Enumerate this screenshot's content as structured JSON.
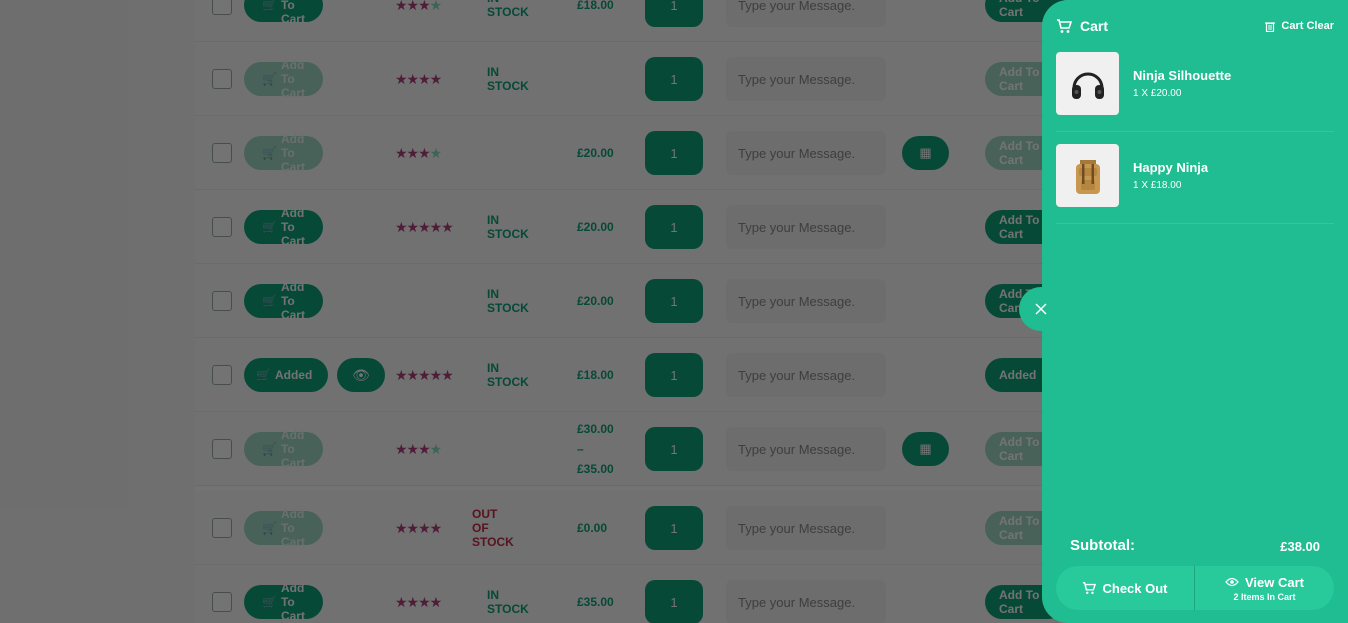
{
  "table": {
    "rows": [
      {
        "button": "Add To Cart",
        "button_state": "normal",
        "stars_on": 3,
        "stars_off": 1,
        "stock": "IN STOCK",
        "stock_type": "in",
        "price": "£18.00",
        "price_extra": "",
        "qty": "1",
        "msg_placeholder": "Type your Message.",
        "quick_view": false,
        "side_button": "Add To Cart",
        "side_faded": false
      },
      {
        "button": "Add To Cart",
        "button_state": "faded",
        "stars_on": 4,
        "stars_off": 0,
        "stock": "IN STOCK",
        "stock_type": "in",
        "price": "",
        "price_extra": "",
        "qty": "1",
        "msg_placeholder": "Type your Message.",
        "quick_view": false,
        "side_button": "Add To Cart",
        "side_faded": true
      },
      {
        "button": "Add To Cart",
        "button_state": "faded",
        "stars_on": 3,
        "stars_off": 1,
        "stock": "",
        "stock_type": "in",
        "price": "£20.00",
        "price_extra": "",
        "qty": "1",
        "msg_placeholder": "Type your Message.",
        "quick_view": true,
        "side_button": "Add To Cart",
        "side_faded": true
      },
      {
        "button": "Add To Cart",
        "button_state": "normal",
        "stars_on": 5,
        "stars_off": 0,
        "stock": "IN STOCK",
        "stock_type": "in",
        "price": "£20.00",
        "price_extra": "",
        "qty": "1",
        "msg_placeholder": "Type your Message.",
        "quick_view": false,
        "side_button": "Add To Cart",
        "side_faded": false
      },
      {
        "button": "Add To Cart",
        "button_state": "normal",
        "stars_on": 0,
        "stars_off": 0,
        "stock": "IN STOCK",
        "stock_type": "in",
        "price": "£20.00",
        "price_extra": "",
        "qty": "1",
        "msg_placeholder": "Type your Message.",
        "quick_view": false,
        "side_button": "Add To Cart",
        "side_faded": false
      },
      {
        "button": "Added",
        "button_state": "added",
        "stars_on": 5,
        "stars_off": 0,
        "stock": "IN STOCK",
        "stock_type": "in",
        "price": "£18.00",
        "price_extra": "",
        "qty": "1",
        "msg_placeholder": "Type your Message.",
        "quick_view": false,
        "side_button": "Added",
        "side_faded": false
      },
      {
        "button": "Add To Cart",
        "button_state": "faded",
        "stars_on": 3,
        "stars_off": 1,
        "stock": "",
        "stock_type": "in",
        "price": "£30.00",
        "price_extra": "£35.00",
        "qty": "1",
        "msg_placeholder": "Type your Message.",
        "quick_view": true,
        "side_button": "Add To Cart",
        "side_faded": true
      },
      {
        "button": "Add To Cart",
        "button_state": "faded",
        "stars_on": 4,
        "stars_off": 0,
        "stock": "OUT OF STOCK",
        "stock_type": "out",
        "price": "£0.00",
        "price_extra": "",
        "qty": "1",
        "msg_placeholder": "Type your Message.",
        "quick_view": false,
        "side_button": "Add To Cart",
        "side_faded": true
      },
      {
        "button": "Add To Cart",
        "button_state": "normal",
        "stars_on": 4,
        "stars_off": 0,
        "stock": "IN STOCK",
        "stock_type": "in",
        "price": "£35.00",
        "price_extra": "",
        "qty": "1",
        "msg_placeholder": "Type your Message.",
        "quick_view": false,
        "side_button": "Add To Cart",
        "side_faded": false
      }
    ]
  },
  "cart": {
    "title": "Cart",
    "clear_label": "Cart Clear",
    "items": [
      {
        "name": "Ninja Silhouette",
        "price_line": "1 X £20.00",
        "thumb_icon": "headphones-icon"
      },
      {
        "name": "Happy Ninja",
        "price_line": "1 X £18.00",
        "thumb_icon": "backpack-icon"
      }
    ],
    "subtotal_label": "Subtotal:",
    "subtotal_value": "£38.00",
    "checkout_label": "Check Out",
    "view_cart_label": "View Cart",
    "items_count_label": "2 Items In Cart",
    "close_icon": "close-icon"
  },
  "colors": {
    "accent": "#21bd92",
    "button": "#0fa37a",
    "star": "#b0417c",
    "out_of_stock": "#c0304a"
  }
}
